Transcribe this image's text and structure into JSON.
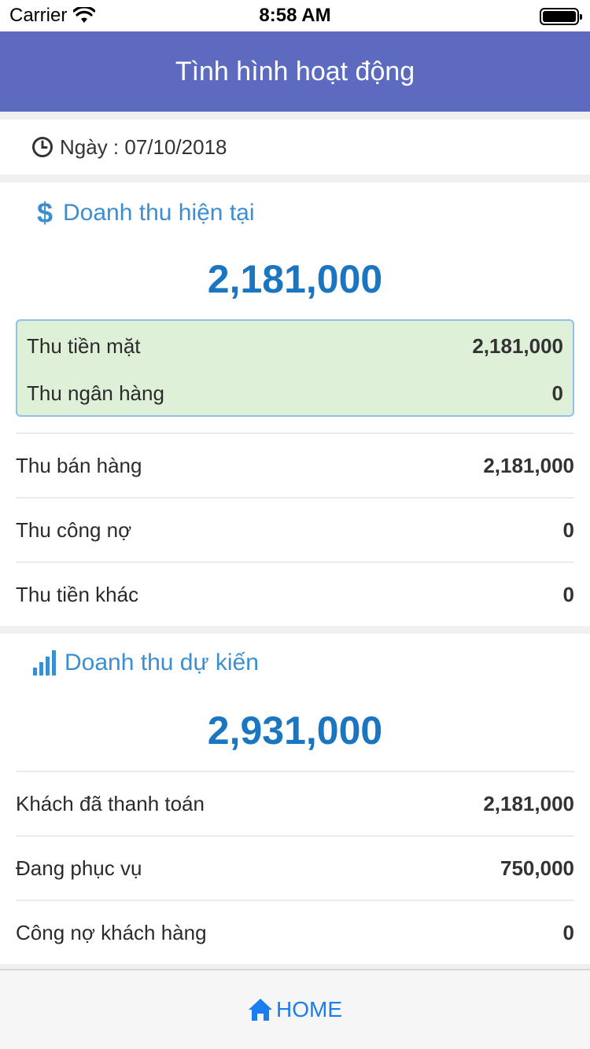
{
  "status_bar": {
    "carrier": "Carrier",
    "time": "8:58 AM"
  },
  "nav": {
    "title": "Tình hình hoạt động"
  },
  "date": {
    "label": "Ngày : 07/10/2018",
    "icon": "clock-icon"
  },
  "current_revenue": {
    "title": "Doanh thu hiện tại",
    "icon": "dollar-icon",
    "total": "2,181,000",
    "payments": [
      {
        "label": "Thu tiền mặt",
        "value": "2,181,000"
      },
      {
        "label": "Thu ngân hàng",
        "value": "0"
      }
    ],
    "rows": [
      {
        "label": "Thu bán hàng",
        "value": "2,181,000"
      },
      {
        "label": "Thu công nợ",
        "value": "0"
      },
      {
        "label": "Thu tiền khác",
        "value": "0"
      }
    ]
  },
  "expected_revenue": {
    "title": "Doanh thu dự kiến",
    "icon": "bar-chart-icon",
    "total": "2,931,000",
    "rows": [
      {
        "label": "Khách đã thanh toán",
        "value": "2,181,000"
      },
      {
        "label": "Đang phục vụ",
        "value": "750,000"
      },
      {
        "label": "Công nợ khách hàng",
        "value": "0"
      }
    ]
  },
  "tab_bar": {
    "home_label": "HOME",
    "icon": "home-icon"
  },
  "colors": {
    "nav_bg": "#5c6bc0",
    "accent_blue": "#1a76c0",
    "section_title": "#3b8fd0",
    "payment_box_bg": "#dff0d8",
    "tab_active": "#1a7df0"
  }
}
